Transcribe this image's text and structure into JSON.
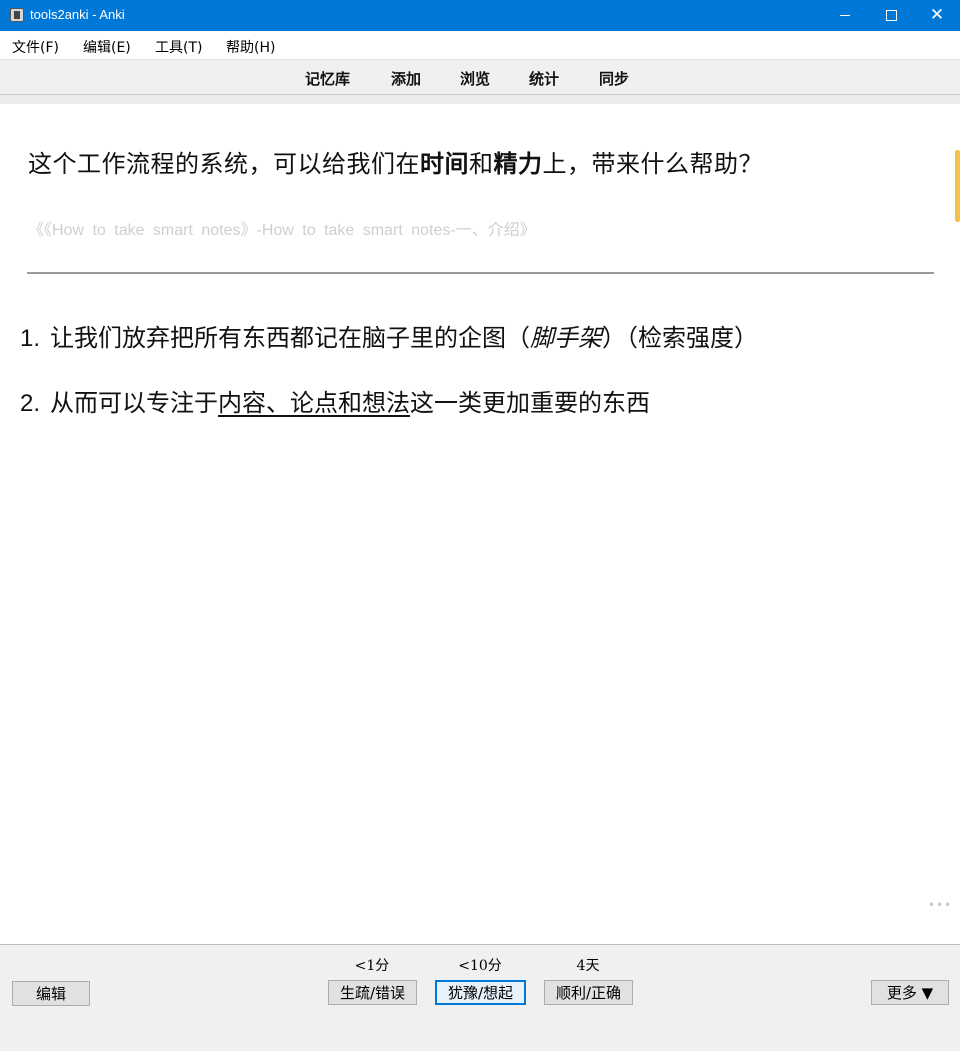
{
  "window": {
    "title": "tools2anki - Anki",
    "minimize_icon": "minimize-icon",
    "maximize_icon": "maximize-icon",
    "close_icon": "close-icon",
    "close_glyph": "✕"
  },
  "menu": [
    "文件(F)",
    "编辑(E)",
    "工具(T)",
    "帮助(H)"
  ],
  "toolbar": [
    "记忆库",
    "添加",
    "浏览",
    "统计",
    "同步"
  ],
  "card": {
    "question_parts": [
      "这个工作流程的系统，可以给我们在",
      "时间",
      "和",
      "精力",
      "上，带来什么帮助？"
    ],
    "source": "《《How to take smart notes》-How to take smart notes-一、介绍》",
    "answers": [
      {
        "num": "1.",
        "text_a": "让我们放弃把所有东西都记在脑子里的企图（",
        "italic": "脚手架",
        "text_b": "）（检索强度）"
      },
      {
        "num": "2.",
        "text_a": "从而可以专注于",
        "underline": "内容、论点和想法",
        "text_b": "这一类更加重要的东西"
      }
    ]
  },
  "bottom": {
    "edit_label": "编辑",
    "more_label": "更多 ▼",
    "answer_buttons": [
      {
        "time": "<1分",
        "label": "生疏/错误"
      },
      {
        "time": "<10分",
        "label": "犹豫/想起"
      },
      {
        "time": "4天",
        "label": "顺利/正确"
      }
    ]
  },
  "colors": {
    "titlebar": "#0078d7",
    "accent": "#f5c14a",
    "source_text": "#cfcfcf"
  }
}
